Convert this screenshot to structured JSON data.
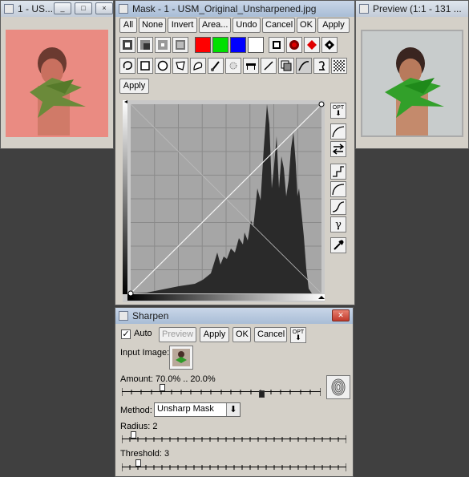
{
  "left_window": {
    "title": "1 - US..."
  },
  "right_window": {
    "title": "Preview (1:1 - 131 ..."
  },
  "mask_window": {
    "title": "Mask - 1 - USM_Original_Unsharpened.jpg",
    "buttons": [
      "All",
      "None",
      "Invert",
      "Area...",
      "Undo",
      "Cancel",
      "OK",
      "Apply"
    ],
    "colors": {
      "red": "#ff0000",
      "green": "#00e000",
      "blue": "#0000ff",
      "white": "#ffffff"
    },
    "apply_label": "Apply",
    "opt_label": "OPT",
    "side_tools": [
      "opt-arrow-icon",
      "curve-icon",
      "swap-icon",
      "step-curve-icon",
      "arc-curve-icon",
      "s-curve-icon",
      "gamma-icon",
      "eyedropper-icon"
    ],
    "gamma_glyph": "γ"
  },
  "sharpen_dialog": {
    "title": "Sharpen",
    "auto_label": "Auto",
    "auto_checked": true,
    "preview_label": "Preview",
    "apply_label": "Apply",
    "ok_label": "OK",
    "cancel_label": "Cancel",
    "opt_label": "OPT",
    "input_image_label": "Input Image:",
    "amount_label": "Amount: 70.0% .. 20.0%",
    "method_label": "Method:",
    "method_value": "Unsharp Mask",
    "radius_label": "Radius: 2",
    "threshold_label": "Threshold: 3",
    "amount_low_fraction": 0.2,
    "amount_high_fraction": 0.7,
    "radius_fraction": 0.05,
    "threshold_fraction": 0.07
  }
}
